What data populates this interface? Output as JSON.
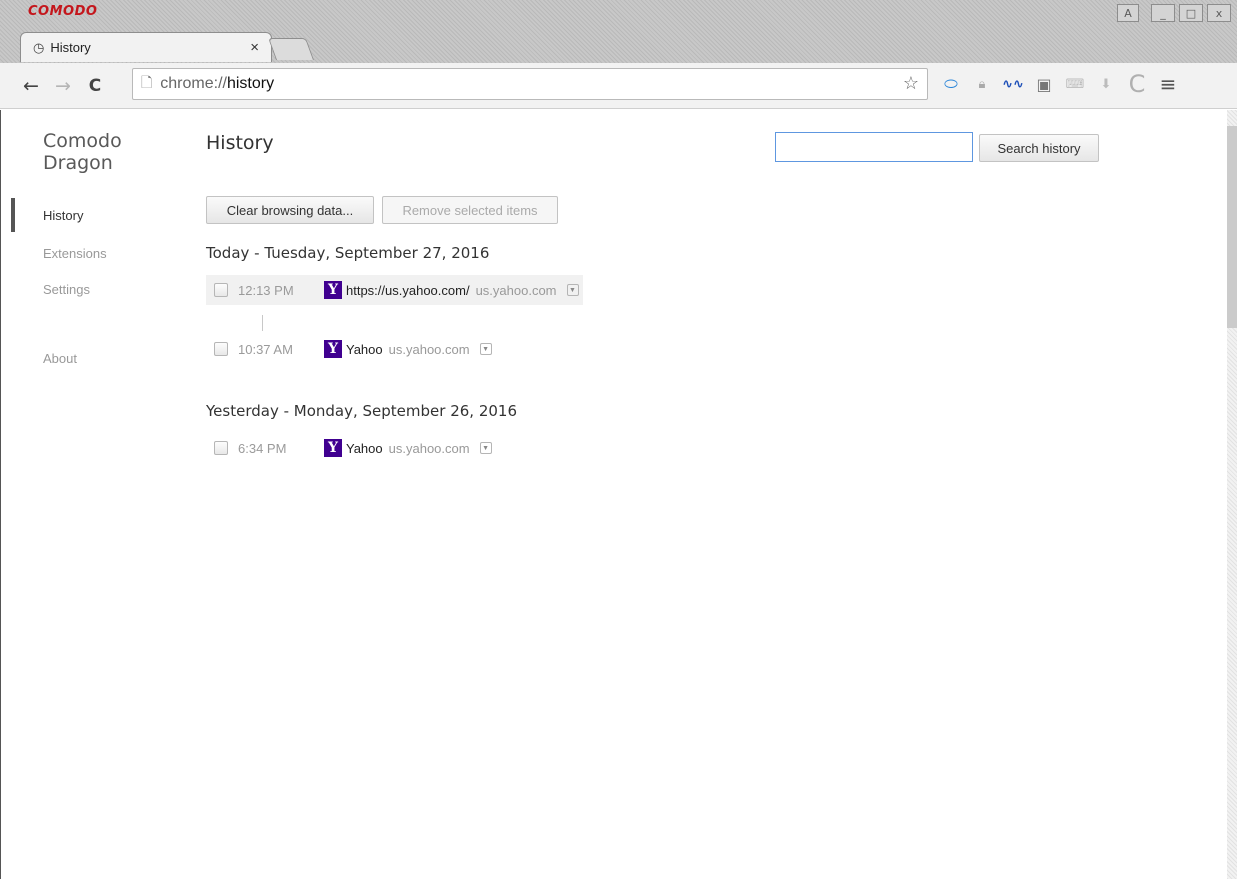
{
  "window": {
    "brand": "COMODO",
    "controls": {
      "user": "A",
      "minimize": "_",
      "maximize": "□",
      "close": "x"
    }
  },
  "tab": {
    "title": "History",
    "icon": "clock-icon",
    "close": "×"
  },
  "toolbar": {
    "back": "←",
    "forward": "→",
    "reload": "C",
    "url_scheme": "chrome://",
    "url_host": "history",
    "star": "☆",
    "menu": "≡"
  },
  "sidebar": {
    "app_title_line1": "Comodo",
    "app_title_line2": "Dragon",
    "items": [
      {
        "label": "History",
        "active": true
      },
      {
        "label": "Extensions"
      },
      {
        "label": "Settings"
      },
      {
        "label": "About"
      }
    ]
  },
  "main": {
    "title": "History",
    "search_button": "Search history",
    "clear_button": "Clear browsing data...",
    "remove_button": "Remove selected items",
    "days": [
      {
        "header": "Today - Tuesday, September 27, 2016",
        "entries": [
          {
            "time": "12:13 PM",
            "title": "https://us.yahoo.com/",
            "domain": "us.yahoo.com",
            "favicon": "Y"
          },
          {
            "time": "10:37 AM",
            "title": "Yahoo",
            "domain": "us.yahoo.com",
            "favicon": "Y"
          }
        ]
      },
      {
        "header": "Yesterday - Monday, September 26, 2016",
        "entries": [
          {
            "time": "6:34 PM",
            "title": "Yahoo",
            "domain": "us.yahoo.com",
            "favicon": "Y"
          }
        ]
      }
    ]
  },
  "colors": {
    "brand": "#c4161c",
    "favicon_bg": "#400090",
    "search_border": "#5e97e0"
  }
}
